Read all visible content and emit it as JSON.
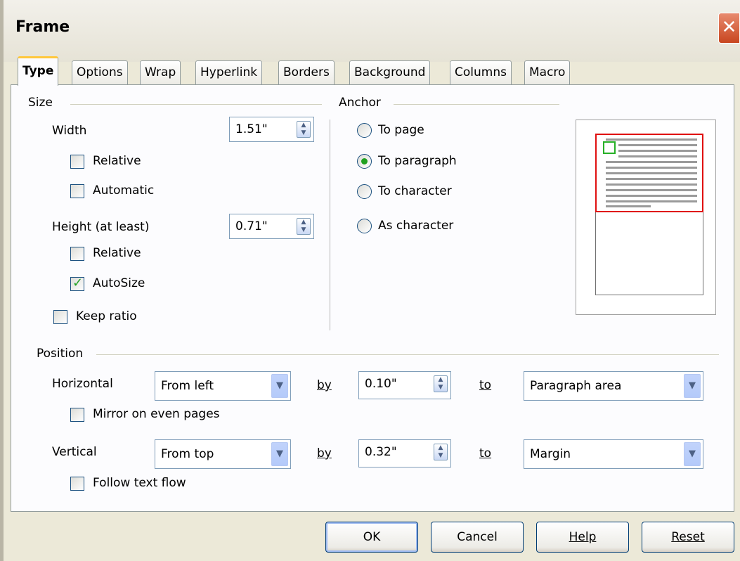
{
  "window": {
    "title": "Frame",
    "close_icon": "close-icon"
  },
  "tabs": [
    {
      "label": "Type",
      "active": true
    },
    {
      "label": "Options"
    },
    {
      "label": "Wrap"
    },
    {
      "label": "Hyperlink"
    },
    {
      "label": "Borders"
    },
    {
      "label": "Background"
    },
    {
      "label": "Columns"
    },
    {
      "label": "Macro"
    }
  ],
  "size": {
    "heading": "Size",
    "width_label": "Width",
    "width_value": "1.51\"",
    "width_relative": {
      "label": "Relative",
      "checked": false
    },
    "width_automatic": {
      "label": "Automatic",
      "checked": false
    },
    "height_label": "Height (at least)",
    "height_value": "0.71\"",
    "height_relative": {
      "label": "Relative",
      "checked": false
    },
    "height_autosize": {
      "label": "AutoSize",
      "checked": true
    },
    "keep_ratio": {
      "label": "Keep ratio",
      "checked": false
    }
  },
  "anchor": {
    "heading": "Anchor",
    "options": [
      {
        "label": "To page",
        "selected": false
      },
      {
        "label": "To paragraph",
        "selected": true
      },
      {
        "label": "To character",
        "selected": false
      },
      {
        "label": "As character",
        "selected": false
      }
    ]
  },
  "position": {
    "heading": "Position",
    "horizontal_label": "Horizontal",
    "horizontal_select": "From left",
    "horizontal_by_label": "by",
    "horizontal_by_value": "0.10\"",
    "horizontal_to_label": "to",
    "horizontal_to_select": "Paragraph area",
    "mirror": {
      "label": "Mirror on even pages",
      "checked": false
    },
    "vertical_label": "Vertical",
    "vertical_select": "From top",
    "vertical_by_label": "by",
    "vertical_by_value": "0.32\"",
    "vertical_to_label": "to",
    "vertical_to_select": "Margin",
    "follow_text_flow": {
      "label": "Follow text flow",
      "checked": false
    }
  },
  "buttons": {
    "ok": "OK",
    "cancel": "Cancel",
    "help": "Help",
    "reset": "Reset"
  },
  "colors": {
    "dialog_bg": "#ECE9D8",
    "active_tab_accent": "#FFC83C",
    "check_green": "#21A121",
    "frame_outline": "#E01010",
    "anchor_marker": "#27B027"
  }
}
